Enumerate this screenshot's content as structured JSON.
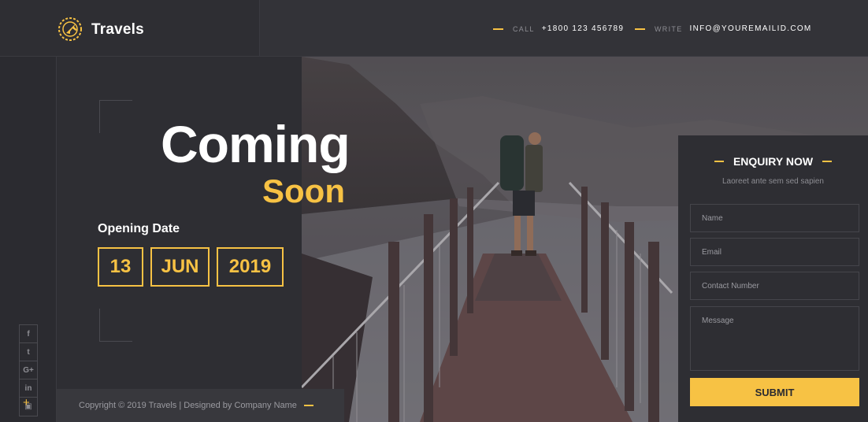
{
  "brand": {
    "name": "Travels",
    "logo_icon": "compass-plane-icon"
  },
  "contact": {
    "call_label": "CALL",
    "call_value": "+1800 123 456789",
    "write_label": "WRITE",
    "write_value": "INFO@YOUREMAILID.COM"
  },
  "hero": {
    "title": "Coming",
    "subtitle": "Soon",
    "opening_label": "Opening Date",
    "day": "13",
    "month": "JUN",
    "year": "2019"
  },
  "social": [
    {
      "name": "facebook-icon",
      "glyph": "f"
    },
    {
      "name": "twitter-icon",
      "glyph": "t"
    },
    {
      "name": "google-plus-icon",
      "glyph": "G+"
    },
    {
      "name": "linkedin-icon",
      "glyph": "in"
    },
    {
      "name": "youtube-icon",
      "glyph": "▣"
    }
  ],
  "footer": {
    "copyright": "Copyright © 2019 Travels  |  Designed by Company Name"
  },
  "enquiry": {
    "heading": "ENQUIRY NOW",
    "subheading": "Laoreet ante sem sed sapien",
    "name_placeholder": "Name",
    "email_placeholder": "Email",
    "phone_placeholder": "Contact Number",
    "message_placeholder": "Message",
    "submit_label": "SUBMIT"
  },
  "colors": {
    "accent": "#f7c244",
    "background": "#2b2b30",
    "panel": "#2e2e33"
  }
}
